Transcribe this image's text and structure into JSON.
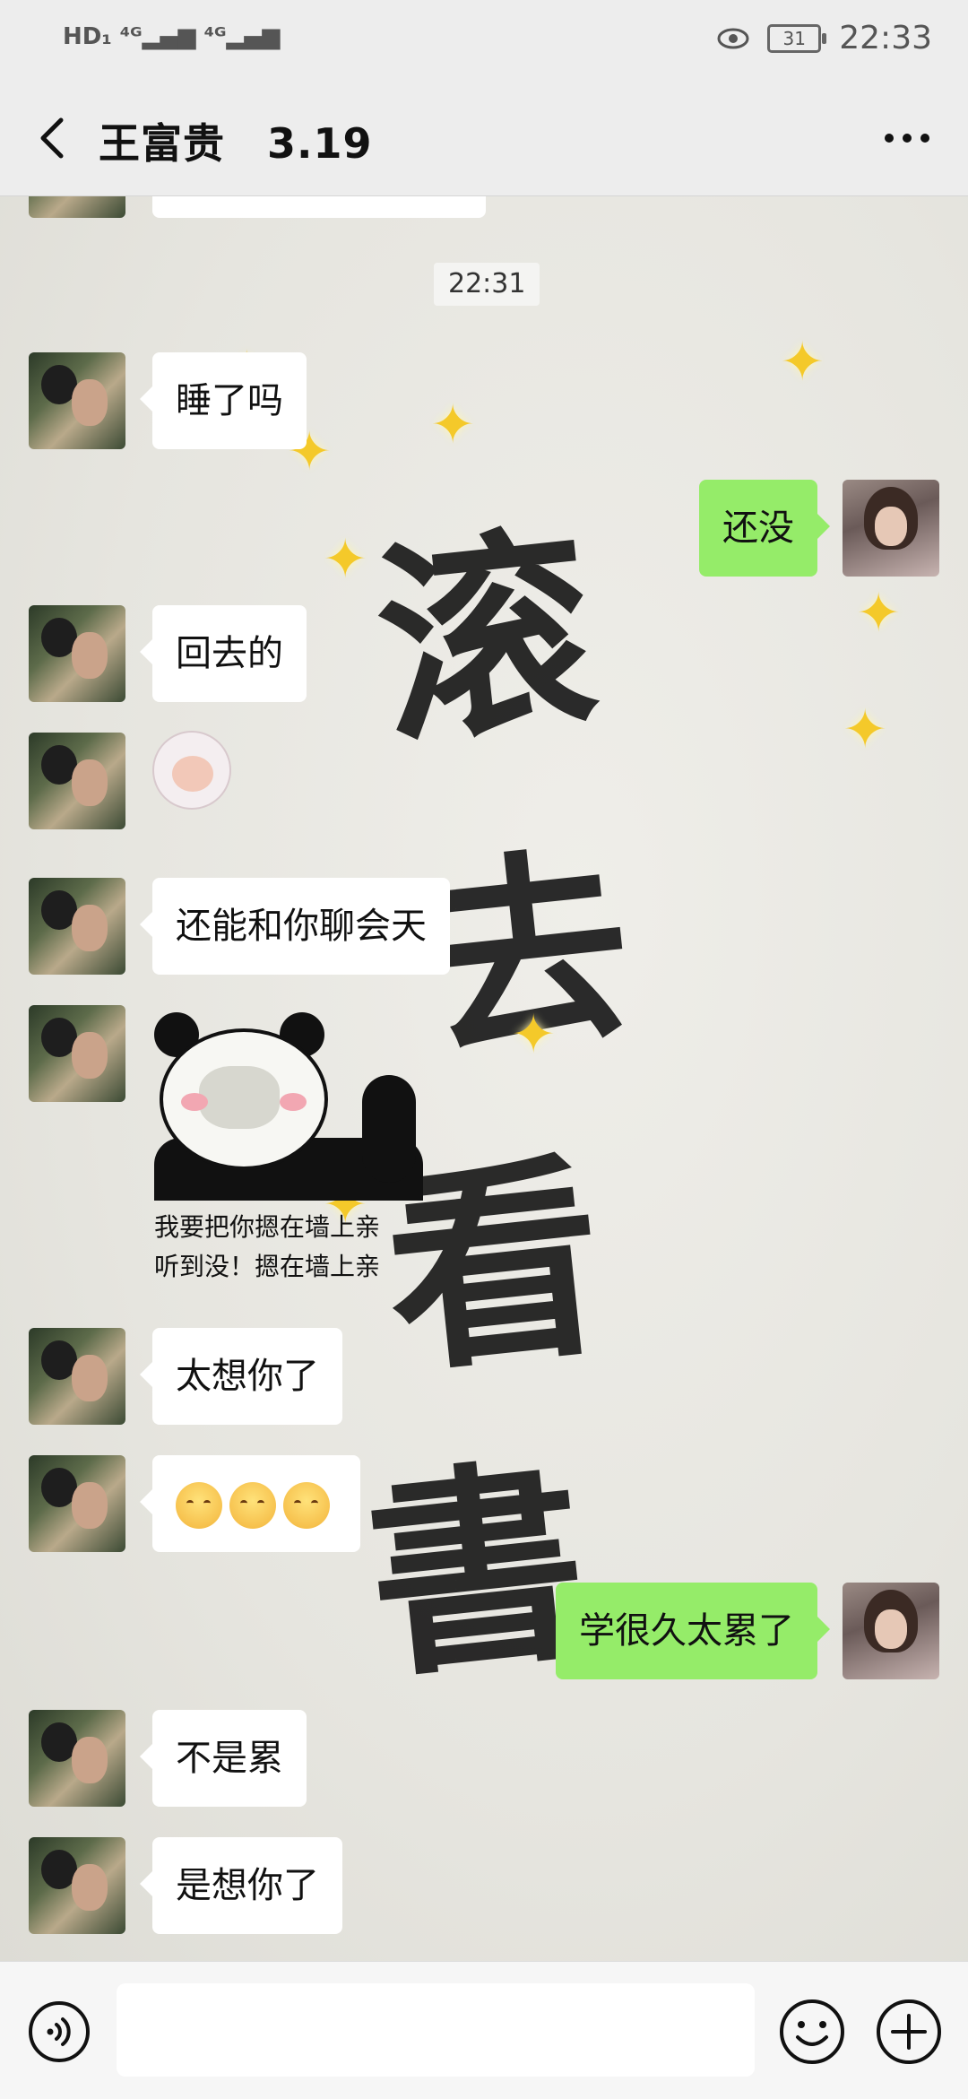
{
  "status_bar": {
    "left": "HD₁ ⁴ᴳ▂▄▆ ⁴ᴳ▂▄▆",
    "battery": "31",
    "time": "22:33",
    "eye_icon": "eye-icon",
    "wifi_icon": "wifi-icon"
  },
  "header": {
    "title": "王富贵　3.19",
    "back_icon": "chevron-left-icon",
    "more_icon": "more-dots-icon"
  },
  "chat": {
    "time_chip": "22:31",
    "messages": [
      {
        "side": "left",
        "text": "睡了吗"
      },
      {
        "side": "right",
        "text": "还没"
      },
      {
        "side": "left",
        "text": "回去的"
      },
      {
        "side": "left",
        "sticker": "cat-facepalm-sticker"
      },
      {
        "side": "left",
        "text": "还能和你聊会天"
      },
      {
        "side": "left",
        "sticker": "panda-meme-sticker",
        "caption_line1": "我要把你摁在墙上亲",
        "caption_line2": "听到没！摁在墙上亲"
      },
      {
        "side": "left",
        "text": "太想你了"
      },
      {
        "side": "left",
        "emoji": "blush-emoji ×3"
      },
      {
        "side": "right",
        "text": "学很久太累了"
      },
      {
        "side": "left",
        "text": "不是累"
      },
      {
        "side": "left",
        "text": "是想你了"
      }
    ],
    "wallpaper_text": [
      "滚",
      "去",
      "看",
      "書"
    ]
  },
  "input_bar": {
    "placeholder": "",
    "voice_icon": "voice-icon",
    "emoji_icon": "smiley-icon",
    "plus_icon": "plus-icon"
  },
  "colors": {
    "bubble_self": "#95ec69",
    "bubble_other": "#ffffff",
    "header_bg": "#ededed",
    "sparkle": "#f4c92a"
  }
}
